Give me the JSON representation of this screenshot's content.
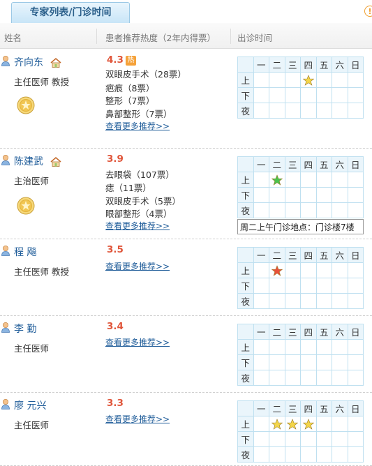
{
  "tab_label": "专家列表/门诊时间",
  "columns": {
    "name": "姓名",
    "heat": "患者推荐热度（2年内得票）",
    "time": "出诊时间"
  },
  "more_label": "查看更多推荐>>",
  "hot_badge": "热",
  "schedule_header": [
    "一",
    "二",
    "三",
    "四",
    "五",
    "六",
    "日"
  ],
  "schedule_rows": [
    "上",
    "下",
    "夜"
  ],
  "tooltip": "周二上午门诊地点：门诊楼7楼",
  "doctors": [
    {
      "name": "齐向东",
      "title": "主任医师 教授",
      "score": "4.3",
      "recs": [
        "双眼皮手术（28票）",
        "疤痕（8票）",
        "整形（7票）",
        "鼻部整形（7票）"
      ]
    },
    {
      "name": "陈建武",
      "title": "主治医师",
      "score": "3.9",
      "recs": [
        "去眼袋（107票）",
        "痣（11票）",
        "双眼皮手术（5票）",
        "眼部整形（4票）"
      ]
    },
    {
      "name": "程  飚",
      "title": "主任医师 教授",
      "score": "3.5",
      "recs": []
    },
    {
      "name": "李  勤",
      "title": "主任医师",
      "score": "3.4",
      "recs": []
    },
    {
      "name": "廖 元兴",
      "title": "主任医师",
      "score": "3.3",
      "recs": []
    }
  ],
  "schedule_stars": [
    {
      "doctor": 0,
      "row": "上",
      "days": [
        "四"
      ],
      "color": "#f3d54a"
    },
    {
      "doctor": 1,
      "row": "上",
      "days": [
        "二"
      ],
      "color": "#4cc24c"
    },
    {
      "doctor": 2,
      "row": "上",
      "days": [
        "二"
      ],
      "color": "#e8513a"
    },
    {
      "doctor": 4,
      "row": "上",
      "days": [
        "二",
        "三",
        "四"
      ],
      "color": "#f3d54a"
    }
  ]
}
